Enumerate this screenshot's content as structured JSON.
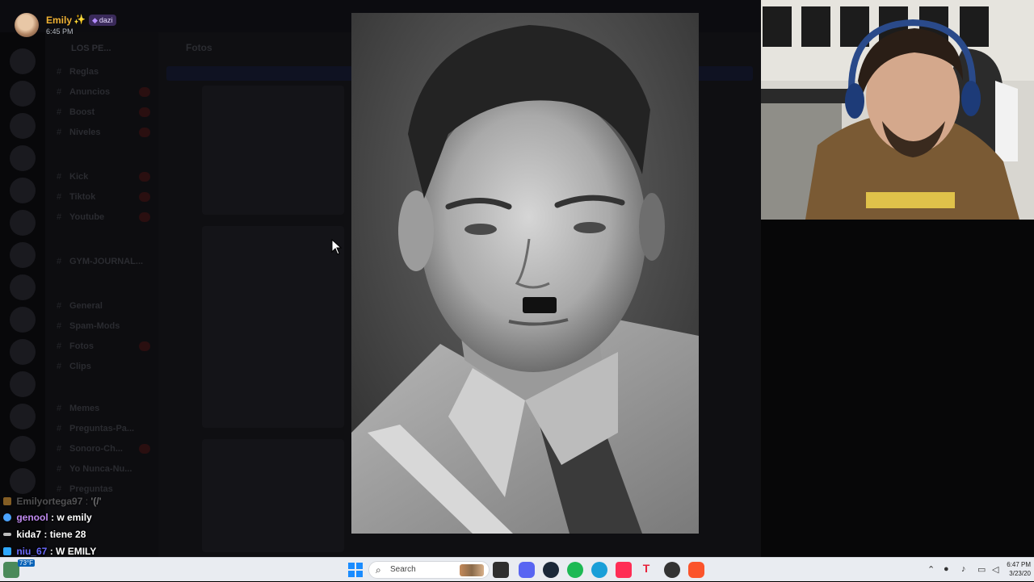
{
  "viewer": {
    "uploader": "Emily",
    "sparkle": "✨",
    "role_badge": "dazi",
    "timestamp": "6:45 PM"
  },
  "discord": {
    "server_name": "LOS PE...",
    "channel_title": "Fotos",
    "channels": [
      {
        "name": "Reglas",
        "icon": "hash-icon"
      },
      {
        "name": "Anuncios",
        "icon": "hash-icon"
      },
      {
        "name": "Boost",
        "icon": "hash-icon"
      },
      {
        "name": "Niveles",
        "icon": "hash-icon"
      },
      {
        "name": "Kick",
        "icon": "hash-icon"
      },
      {
        "name": "Tiktok",
        "icon": "hash-icon"
      },
      {
        "name": "Youtube",
        "icon": "hash-icon"
      },
      {
        "name": "GYM-JOURNAL...",
        "icon": "hash-icon"
      },
      {
        "name": "General",
        "icon": "hash-icon"
      },
      {
        "name": "Spam-Mods",
        "icon": "hash-icon"
      },
      {
        "name": "Fotos",
        "icon": "hash-icon"
      },
      {
        "name": "Clips",
        "icon": "hash-icon"
      },
      {
        "name": "Memes",
        "icon": "hash-icon"
      },
      {
        "name": "Preguntas-Pa...",
        "icon": "hash-icon"
      },
      {
        "name": "Sonoro-Ch...",
        "icon": "hash-icon"
      },
      {
        "name": "Yo Nunca-Nu...",
        "icon": "hash-icon"
      },
      {
        "name": "Preguntas",
        "icon": "hash-icon"
      }
    ]
  },
  "stream_chat": [
    {
      "user": "Emilyortega97",
      "sep": " : ",
      "message": "'(/'",
      "color": "#8a8a8a"
    },
    {
      "user": "genool",
      "sep": " : ",
      "message": "w emily",
      "color": "#c08af0"
    },
    {
      "user": "kida7",
      "sep": " : ",
      "message": "tiene 28",
      "color": "#ffffff"
    },
    {
      "user": "niu_67",
      "sep": " : ",
      "message": "W EMILY",
      "color": "#6b6bff"
    },
    {
      "user": "niu_67",
      "sep": " : ",
      "message": "",
      "color": "#6b6bff"
    }
  ],
  "taskbar": {
    "search_label": "Search",
    "weather_temp": "73°F",
    "time": "6:47 PM",
    "date": "3/23/20"
  },
  "icons": {
    "start": "windows-start-icon",
    "search": "search-icon",
    "discord": "discord-icon",
    "steam": "steam-icon",
    "spotify": "spotify-icon",
    "edge": "edge-icon",
    "tiktok": "tiktok-icon",
    "brave": "brave-icon"
  }
}
